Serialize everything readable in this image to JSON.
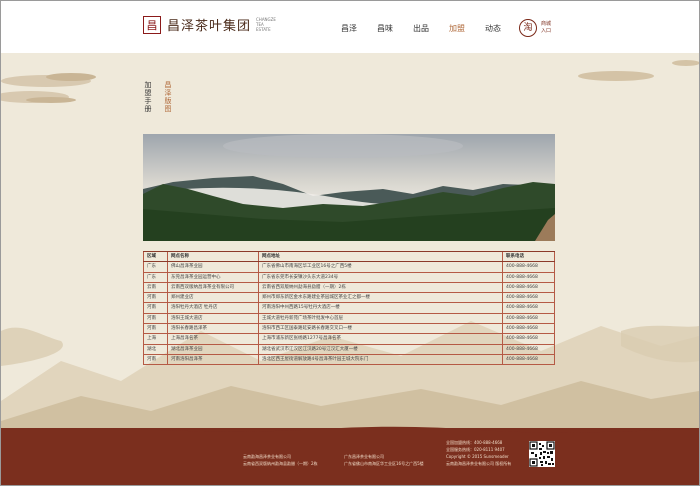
{
  "header": {
    "logo_seal": "昌",
    "logo_name": "昌泽茶叶集团",
    "logo_en": "CHANGZE TEA ESTATE",
    "nav": [
      {
        "label": "昌泽",
        "active": false
      },
      {
        "label": "昌味",
        "active": false
      },
      {
        "label": "出品",
        "active": false
      },
      {
        "label": "加盟",
        "active": true
      },
      {
        "label": "动态",
        "active": false
      }
    ],
    "mall_icon": "淘",
    "mall_label": "商城入口"
  },
  "side": {
    "manual": "加盟手册",
    "layout": "昌泽版图"
  },
  "table": {
    "headers": [
      "区域",
      "网点名称",
      "网点地址",
      "联系电话"
    ],
    "rows": [
      [
        "广东",
        "佛山昌泽茶业园",
        "广东省佛山市南海区华工业区16号之广西5楼",
        "400-888-4668"
      ],
      [
        "广东",
        "东莞昌泽茶业园运营中心",
        "广东省东莞市长安镇沙头东大道234号",
        "400-888-4668"
      ],
      [
        "云南",
        "云南西双版纳昌泽茶业有限公司",
        "云南省西双版纳州勐海县勐腊（一期）2栋",
        "400-888-4668"
      ],
      [
        "河南",
        "郑州建业店",
        "郑州市郑东新区金水东路建业茶园城区茶业汇之都一楼",
        "400-888-4668"
      ],
      [
        "河南",
        "洛阳牡丹大酒店 牡丹店",
        "河南洛阳中州西路15号牡丹大酒店一楼",
        "400-888-4668"
      ],
      [
        "河南",
        "洛阳王城大道店",
        "王城大道牡丹新苑广场茶叶批发中心首层",
        "400-888-4668"
      ],
      [
        "河南",
        "洛阳长春路昌泽茶",
        "洛阳市西工区国泰路延安路长春路交叉口一楼",
        "400-888-4668"
      ],
      [
        "上海",
        "上海昌泽名茶",
        "上海市浦东新区张杨路1277号昌泽名茶",
        "400-888-4668"
      ],
      [
        "湖北",
        "湖北昌泽茶业园",
        "湖北省武汉市江汉区江汉路20号江汉汇大厦一楼",
        "400-888-4668"
      ],
      [
        "河南",
        "河南洛阳昌泽茶",
        "洛北区西王屋街道解放路4号昌泽茶叶园王城大院东门",
        "400-888-4668"
      ]
    ]
  },
  "footer": {
    "company1_name": "云南勐海昌泽茶业有限公司",
    "company1_addr": "云南省西双版纳州勐海县勐腊（一期）2栋",
    "company2_name": "广东昌泽茶业有限公司",
    "company2_addr": "广东省佛山市南海区华工业区16号之广西5楼",
    "hotline1": "全国加盟热线：400-888-4668",
    "hotline2": "全国服务热线：020-8111 9407",
    "copyright": "Copyright © 2015 Sunsmeader",
    "rights": "云南勐海昌泽茶业有限公司 版权所有"
  },
  "colors": {
    "brand_red": "#7b2f1e",
    "accent": "#b06a3b",
    "bg": "#efe9da"
  }
}
